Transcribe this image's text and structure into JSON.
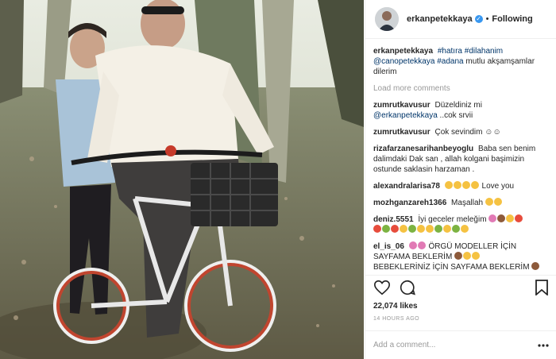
{
  "post": {
    "username": "erkanpetekkaya",
    "follow_status": "Following",
    "separator": "•",
    "caption": {
      "user": "erkanpetekkaya",
      "hashtags": "#hatıra #dilahanim",
      "mention": "@canopetekkaya",
      "hashtag2": "#adana",
      "text": "mutlu akşamşamlar dilerim"
    },
    "load_more": "Load more comments",
    "likes": "22,074 likes",
    "time": "14 HOURS AGO",
    "add_comment_placeholder": "Add a comment..."
  },
  "comments": [
    {
      "user": "zumrutkavusur",
      "text": "Düzeldiniz mi",
      "mention": "@erkanpetekkaya",
      "tail": "..cok srvii"
    },
    {
      "user": "zumrutkavusur",
      "text": "Çok sevindim ☺☺"
    },
    {
      "user": "rizafarzanesarihanbeyoglu",
      "text": "Baba sen benim dalimdaki Dak san , allah kolgani başimizin ostunde saklasin harzaman ."
    },
    {
      "user": "alexandralarisa78",
      "text": "Love you"
    },
    {
      "user": "mozhganzareh1366",
      "text": "Maşallah"
    },
    {
      "user": "deniz.5551",
      "text": "İyi geceler meleğim"
    },
    {
      "user": "el_is_06",
      "text": "ÖRGÜ MODELLER İÇİN SAYFAMA BEKLERİM",
      "text2": "BEBEKLERİNİZ İÇİN SAYFAMA BEKLERİM"
    }
  ],
  "icons": {
    "like": "heart-icon",
    "comment": "comment-icon",
    "save": "bookmark-icon",
    "more": "more-options-icon"
  }
}
